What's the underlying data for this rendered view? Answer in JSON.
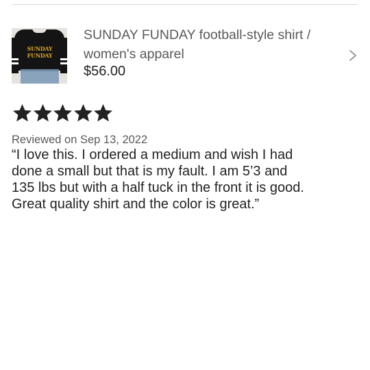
{
  "listing": {
    "thumbnail_alt": "SUNDAY FUNDAY",
    "title": "SUNDAY FUNDAY football-style shirt / women's apparel",
    "price": "$56.00"
  },
  "review": {
    "rating": 5,
    "date": "Reviewed on Sep 13, 2022",
    "text": "“I love this. I ordered a medium and wish I had\ndone a small but that is my fault. I am 5’3 and\n135 lbs but with a half tuck in the front it is good.\nGreat quality shirt and the color is great.”"
  },
  "icons": {
    "chevron": "chevron-right-icon",
    "star": "star-icon"
  },
  "colors": {
    "star": "#222222",
    "chevron": "#9a9a9a"
  }
}
